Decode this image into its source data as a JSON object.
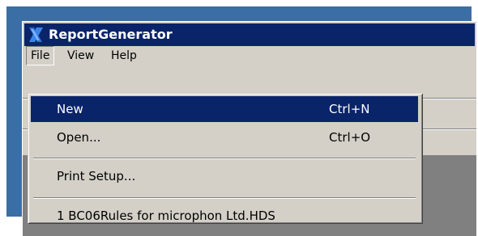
{
  "window": {
    "title": "ReportGenerator"
  },
  "menubar": {
    "items": [
      {
        "label": "File"
      },
      {
        "label": "View"
      },
      {
        "label": "Help"
      }
    ]
  },
  "file_menu": {
    "items": [
      {
        "label": "New",
        "shortcut": "Ctrl+N",
        "highlighted": true
      },
      {
        "label": "Open...",
        "shortcut": "Ctrl+O"
      },
      {
        "label": "Print Setup...",
        "shortcut": ""
      },
      {
        "label": "1 BC06Rules for microphon Ltd.HDS",
        "shortcut": ""
      }
    ]
  },
  "colors": {
    "titlebar": "#0a246a",
    "highlight": "#0a246a",
    "face": "#d4d0c8",
    "desktop": "#3a6ea5"
  },
  "icons": {
    "app": "app-logo-icon"
  }
}
